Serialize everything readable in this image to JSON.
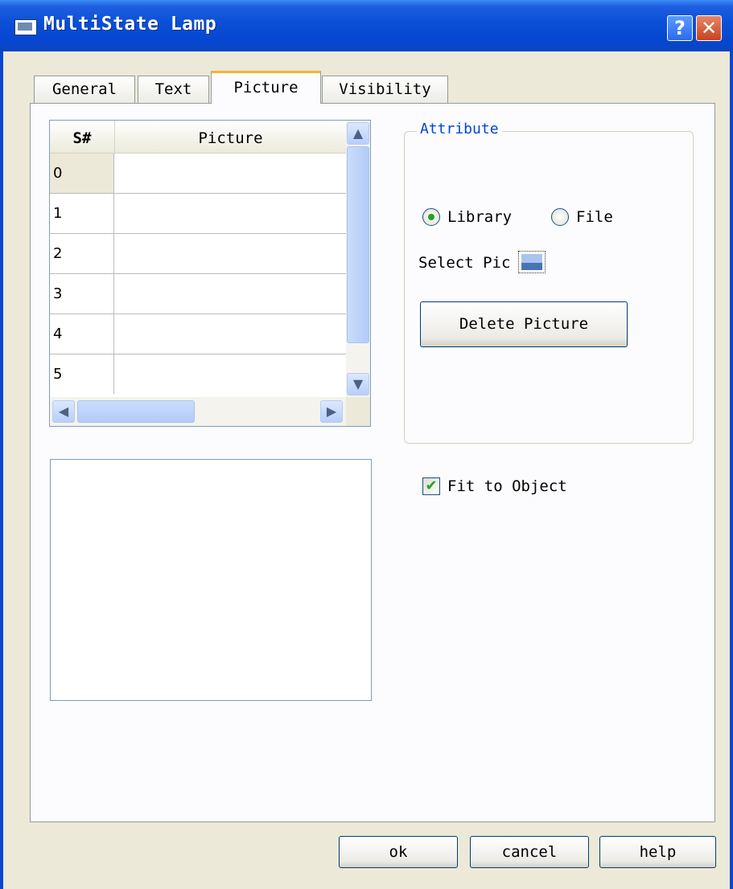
{
  "window": {
    "title": "MultiState Lamp",
    "help_glyph": "?",
    "close_glyph": "✕"
  },
  "tabs": [
    {
      "label": "General",
      "active": false
    },
    {
      "label": "Text",
      "active": false
    },
    {
      "label": "Picture",
      "active": true
    },
    {
      "label": "Visibility",
      "active": false
    }
  ],
  "picture_table": {
    "columns": [
      "S#",
      "Picture"
    ],
    "rows": [
      {
        "s": "0",
        "picture": ""
      },
      {
        "s": "1",
        "picture": ""
      },
      {
        "s": "2",
        "picture": ""
      },
      {
        "s": "3",
        "picture": ""
      },
      {
        "s": "4",
        "picture": ""
      },
      {
        "s": "5",
        "picture": ""
      }
    ]
  },
  "attribute": {
    "group_title": "Attribute",
    "source_options": [
      "Library",
      "File"
    ],
    "selected_source": "Library",
    "select_pic_label": "Select Pic",
    "delete_button": "Delete Picture"
  },
  "fit_to_object": {
    "label": "Fit to Object",
    "checked": true
  },
  "footer": {
    "ok": "ok",
    "cancel": "cancel",
    "help": "help"
  },
  "icons": {
    "app": "window-icon",
    "select_pic": "picture-icon",
    "scroll_up": "▲",
    "scroll_down": "▼",
    "scroll_left": "◀",
    "scroll_right": "▶"
  },
  "colors": {
    "titlebar": "#0a4fd6",
    "active_tab_accent": "#f7b236",
    "group_title": "#0046d5",
    "check": "#21a121"
  }
}
